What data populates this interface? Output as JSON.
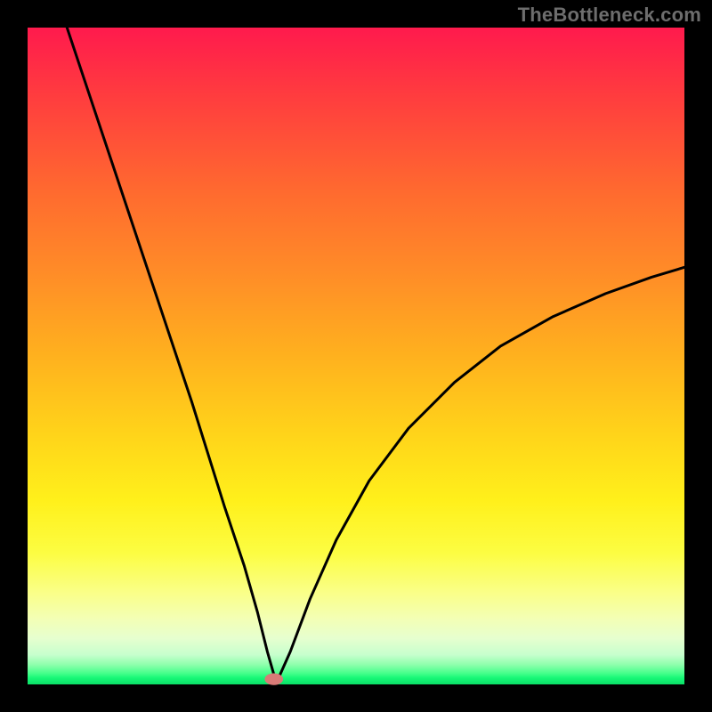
{
  "watermark": "TheBottleneck.com",
  "chart_data": {
    "type": "line",
    "title": "",
    "xlabel": "",
    "ylabel": "",
    "xlim": [
      0,
      100
    ],
    "ylim": [
      0,
      100
    ],
    "grid": false,
    "legend": false,
    "series": [
      {
        "name": "bottleneck-curve",
        "comment": "V-shaped bottleneck curve. Left arm is roughly linear from top-left to the minimum; right arm curves up toward ~63% at the right edge.",
        "x": [
          6,
          10,
          15,
          20,
          25,
          30,
          33,
          35,
          36.5,
          37.5,
          38,
          40,
          43,
          47,
          52,
          58,
          65,
          72,
          80,
          88,
          95,
          100
        ],
        "y": [
          100,
          88,
          73,
          58,
          43,
          27,
          18,
          11,
          5,
          1.5,
          0.5,
          5,
          13,
          22,
          31,
          39,
          46,
          51.5,
          56,
          59.5,
          62,
          63.5
        ]
      }
    ],
    "marker": {
      "name": "optimum-marker",
      "comment": "Small salmon oval marking the curve minimum at the baseline",
      "x": 37.5,
      "y": 0.8,
      "rx_frac": 1.4,
      "ry_frac": 0.9,
      "color": "#d97b77"
    },
    "colors": {
      "frame": "#000000",
      "curve_stroke": "#000000",
      "gradient_top": "#ff1a4d",
      "gradient_mid": "#ffe21a",
      "gradient_bottom": "#0adf67"
    }
  }
}
